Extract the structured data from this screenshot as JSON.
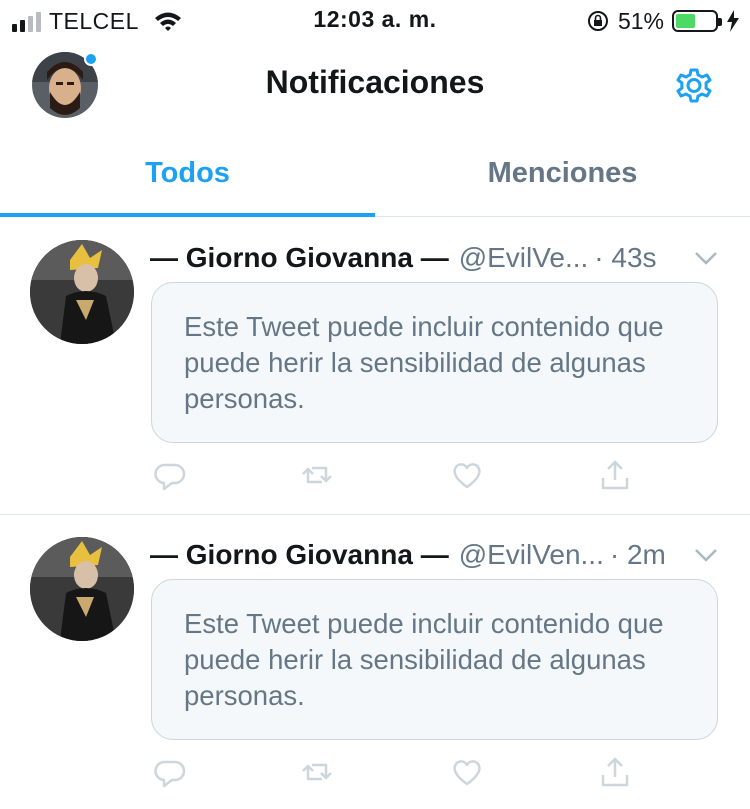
{
  "status_bar": {
    "carrier": "TELCEL",
    "time": "12:03 a. m.",
    "battery_percent": "51%",
    "battery_level": 0.51,
    "icons": [
      "signal-icon",
      "wifi-icon",
      "rotation-lock-icon",
      "battery-icon",
      "charging-icon"
    ]
  },
  "header": {
    "title": "Notificaciones",
    "has_unread_dot": true,
    "settings_icon": "gear-icon"
  },
  "tabs": [
    {
      "label": "Todos",
      "active": true
    },
    {
      "label": "Menciones",
      "active": false
    }
  ],
  "tweets": [
    {
      "name": "— Giorno Giovanna —",
      "handle": "@EvilVe...",
      "time": "· 43s",
      "sensitive_text": "Este Tweet puede incluir contenido que puede herir la sensibilidad de algunas personas."
    },
    {
      "name": "— Giorno Giovanna —",
      "handle": "@EvilVen...",
      "time": "· 2m",
      "sensitive_text": "Este Tweet puede incluir contenido que puede herir la sensibilidad de algunas personas."
    }
  ],
  "colors": {
    "accent": "#1da1f2",
    "muted": "#657786",
    "battery": "#4cd964"
  }
}
